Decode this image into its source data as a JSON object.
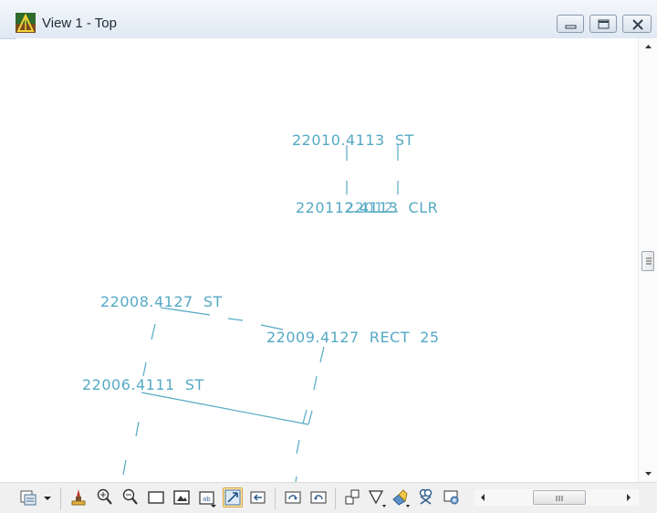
{
  "window": {
    "title": "View 1 - Top",
    "icon": "microstation-view-icon",
    "controls": [
      "minimize-icon",
      "maximize-icon",
      "close-icon"
    ]
  },
  "drawing": {
    "labels": [
      {
        "id": "p22010",
        "text": "22010.4113  ST"
      },
      {
        "id": "p22011",
        "text": "220112.4113  CLR"
      },
      {
        "id": "p22012",
        "text": "22012"
      },
      {
        "id": "p22008",
        "text": "22008.4127  ST"
      },
      {
        "id": "p22009",
        "text": "22009.4127  RECT  25"
      },
      {
        "id": "p22006",
        "text": "22006.4111  ST"
      }
    ],
    "line_color": "#55a9c4"
  },
  "toolbar": {
    "buttons": [
      "view-attributes-icon",
      "dropdown-arrow-icon",
      "update-view-icon",
      "zoom-in-icon",
      "zoom-out-icon",
      "window-area-icon",
      "fit-view-icon",
      "rotate-view-icon",
      "pan-view-icon",
      "view-previous-icon",
      "view-next-icon",
      "copy-view-icon",
      "clip-volume-icon",
      "render-icon",
      "camera-icon",
      "saved-views-icon"
    ],
    "active_button": "pan-view-icon",
    "scroll_grip": "grip-icon"
  }
}
